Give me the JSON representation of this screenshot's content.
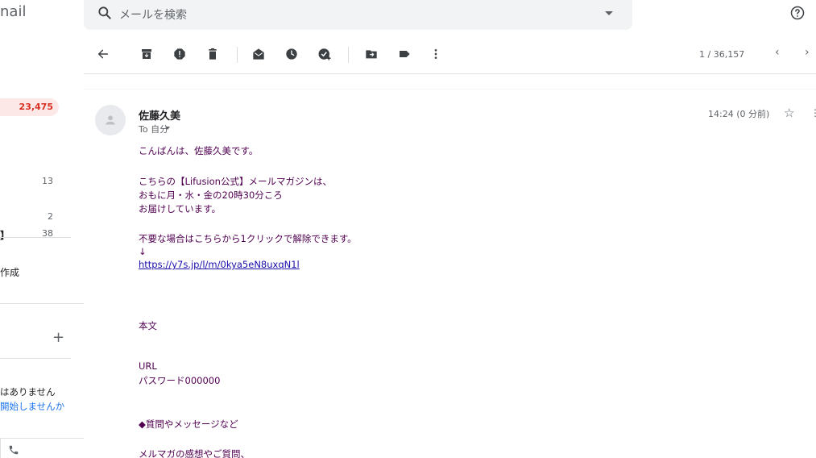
{
  "app": {
    "brand_fragment": "nail"
  },
  "sidebar": {
    "inbox_count": "23,475",
    "counts": [
      "13",
      "2",
      "38"
    ],
    "partial_labels": [
      "】",
      "作成"
    ],
    "empty_state": [
      "はありません",
      "開始しませんか"
    ]
  },
  "search": {
    "placeholder": "メールを検索"
  },
  "toolbar": {
    "icons": [
      "back-arrow-icon",
      "archive-icon",
      "report-spam-icon",
      "delete-icon",
      "mark-unread-icon",
      "snooze-icon",
      "add-task-icon",
      "move-to-icon",
      "label-icon",
      "more-vert-icon"
    ],
    "pagination": "1 / 36,157"
  },
  "message": {
    "sender": "佐藤久美",
    "to": "To 自分",
    "timestamp": "14:24 (0 分前)",
    "body": [
      "こんばんは、佐藤久美です。",
      "こちらの【Lifusion公式】メールマガジンは、",
      "おもに月・水・金の20時30分ころ",
      "お届けしています。",
      "不要な場合はこちらから1クリックで解除できます。",
      "↓",
      "https://y7s.jp/l/m/0kya5eN8uxqN1l",
      "本文",
      "URL",
      "パスワード000000",
      "◆質問やメッセージなど",
      "メルマガの感想やご質問、"
    ]
  },
  "colors": {
    "accent_red": "#d93025",
    "body_text": "#500050",
    "link": "#1a0dab"
  }
}
